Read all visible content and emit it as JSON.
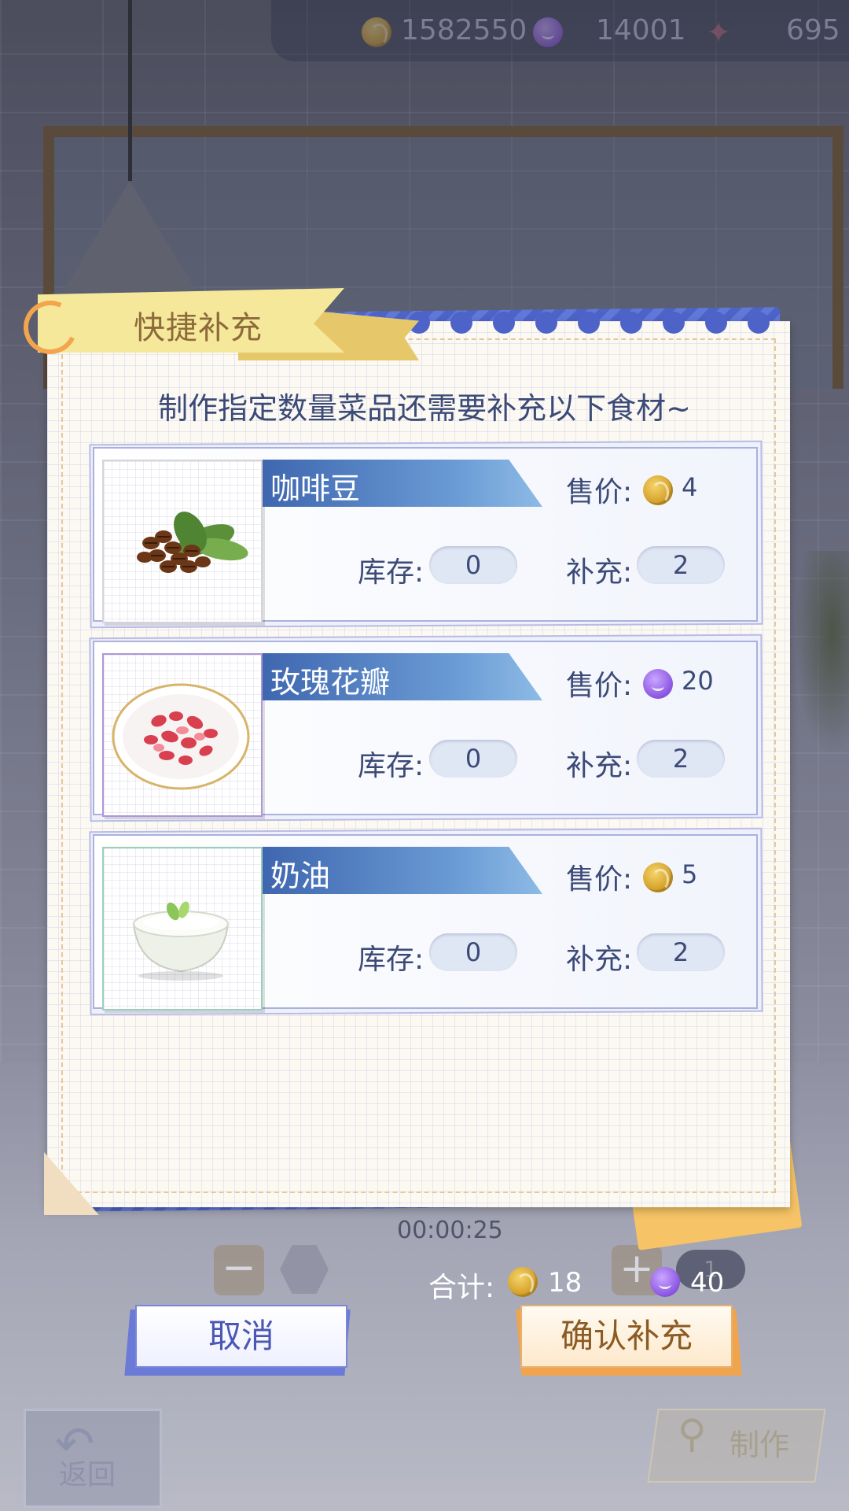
{
  "currency": {
    "coins": "1582550",
    "gems": "14001",
    "tickets": "695"
  },
  "background": {
    "timer": "00:00:25",
    "quantity": "1",
    "back_label": "返回",
    "make_label": "制作"
  },
  "dialog": {
    "title": "快捷补充",
    "instruction": "制作指定数量菜品还需要补充以下食材~",
    "labels": {
      "price": "售价:",
      "stock": "库存:",
      "supply": "补充:"
    },
    "items": [
      {
        "name": "咖啡豆",
        "price_currency": "coin-icon",
        "price": "4",
        "stock": "0",
        "supply": "2"
      },
      {
        "name": "玫瑰花瓣",
        "price_currency": "gem-icon",
        "price": "20",
        "stock": "0",
        "supply": "2"
      },
      {
        "name": "奶油",
        "price_currency": "coin-icon",
        "price": "5",
        "stock": "0",
        "supply": "2"
      }
    ],
    "total": {
      "label": "合计:",
      "coins": "18",
      "gems": "40"
    },
    "buttons": {
      "cancel": "取消",
      "confirm": "确认补充"
    }
  },
  "colors": {
    "accent_blue": "#4d63c8",
    "coin": "#d19b22",
    "gem": "#8a54e0",
    "text": "#3c4a77"
  }
}
